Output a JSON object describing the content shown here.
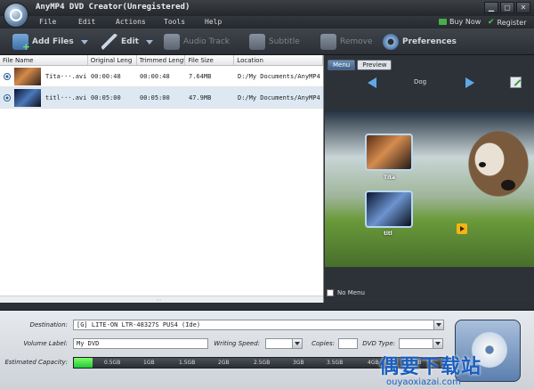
{
  "app": {
    "title": "AnyMP4 DVD Creator(Unregistered)"
  },
  "window_buttons": {
    "minimize": "▁",
    "restore": "▢",
    "close": "✕"
  },
  "menu": {
    "items": [
      "File",
      "Edit",
      "Actions",
      "Tools",
      "Help"
    ],
    "buy_now": "Buy Now",
    "register": "Register"
  },
  "toolbar": {
    "add_files": "Add Files",
    "edit": "Edit",
    "audio_track": "Audio Track",
    "subtitle": "Subtitle",
    "remove": "Remove",
    "preferences": "Preferences"
  },
  "file_list": {
    "columns": [
      "File Name",
      "Original Leng",
      "Trimmed Lengt",
      "File Size",
      "Location"
    ],
    "rows": [
      {
        "name": "Tita···.avi",
        "original": "00:00:48",
        "trimmed": "00:00:48",
        "size": "7.64MB",
        "location": "D:/My Documents/AnyMP4 V···"
      },
      {
        "name": "titl···.avi",
        "original": "00:05:00",
        "trimmed": "00:05:00",
        "size": "47.9MB",
        "location": "D:/My Documents/AnyMP4 V···"
      }
    ],
    "scroll_grip": "⋯"
  },
  "preview": {
    "tabs": [
      "Menu",
      "Preview"
    ],
    "active_tab": "Menu",
    "theme_name": "Dog",
    "chapters": [
      "Tita",
      "titl"
    ],
    "no_menu": "No Menu"
  },
  "bottom": {
    "destination_label": "Destination:",
    "destination_value": "[G] LITE-ON LTR-48327S PUS4 (Ide)",
    "volume_label": "Volume Label:",
    "volume_value": "My DVD",
    "writing_speed_label": "Writing Speed:",
    "copies_label": "Copies:",
    "dvd_type_label": "DVD Type:",
    "capacity_label": "Estimated Capacity:",
    "capacity_ticks": [
      "0.5GB",
      "1GB",
      "1.5GB",
      "2GB",
      "2.5GB",
      "3GB",
      "3.5GB",
      "4GB",
      "4.5GB"
    ],
    "capacity_used_fraction": 0.05
  },
  "watermark": {
    "cn": "偶要下载站",
    "en": "ouyaoxiazai.com"
  }
}
